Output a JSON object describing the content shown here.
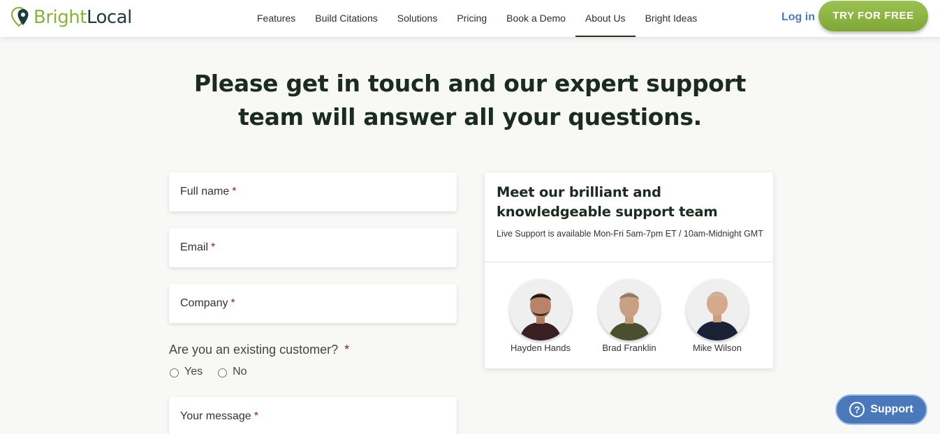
{
  "header": {
    "logo": {
      "bright": "Bright",
      "local": "Local"
    },
    "nav": [
      "Features",
      "Build Citations",
      "Solutions",
      "Pricing",
      "Book a Demo",
      "About Us",
      "Bright Ideas"
    ],
    "active_nav": "About Us",
    "login_label": "Log in",
    "cta_label": "TRY FOR FREE"
  },
  "hero": {
    "title_line1": "Please get in touch and our expert support",
    "title_line2": "team will answer all your questions."
  },
  "form": {
    "full_name_label": "Full name",
    "email_label": "Email",
    "company_label": "Company",
    "message_label": "Your message",
    "required_mark": "*",
    "customer_question": "Are you an existing customer?",
    "radio_yes": "Yes",
    "radio_no": "No"
  },
  "team_card": {
    "title": "Meet our brilliant and knowledgeable support team",
    "subtitle": "Live Support is available Mon-Fri 5am-7pm ET / 10am-Midnight GMT",
    "members": [
      {
        "name": "Hayden Hands"
      },
      {
        "name": "Brad Franklin"
      },
      {
        "name": "Mike Wilson"
      }
    ]
  },
  "support_widget": {
    "label": "Support",
    "icon": "question-icon"
  },
  "colors": {
    "brand_green": "#8bb13f",
    "brand_dark": "#1f3a3d",
    "link_blue": "#4a7ab8",
    "support_blue": "#4a78b8",
    "required_red": "#8a1c1c"
  }
}
